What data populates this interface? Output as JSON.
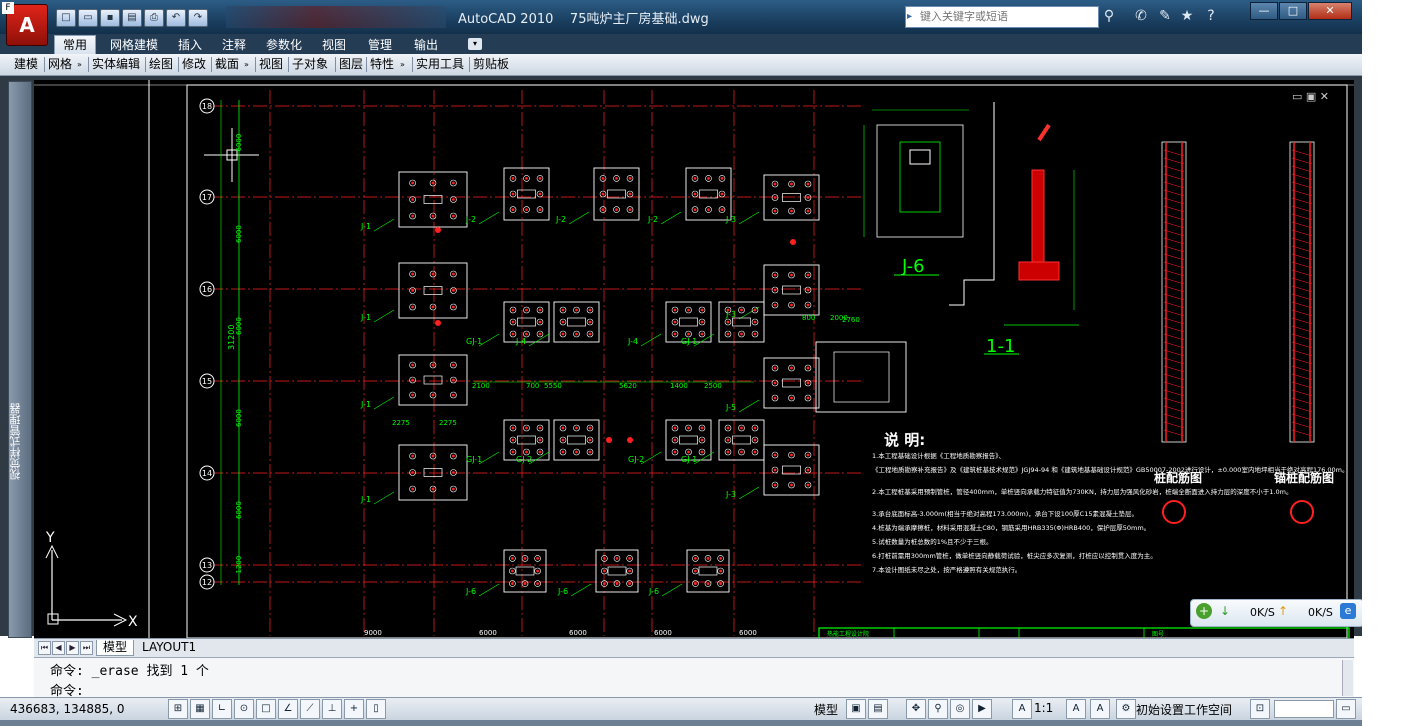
{
  "app": {
    "logo_letter": "A",
    "corner_tag": "F",
    "title": "AutoCAD 2010",
    "file_name": "75吨炉主厂房基础.dwg",
    "search_placeholder": "键入关键字或短语"
  },
  "ribbon": {
    "tabs": [
      "常用",
      "网格建模",
      "插入",
      "注释",
      "参数化",
      "视图",
      "管理",
      "输出"
    ],
    "active_tab": 0,
    "panels": [
      "建模",
      "网格",
      "实体编辑",
      "绘图",
      "修改",
      "截面",
      "视图",
      "子对象",
      "图层",
      "特性",
      "实用工具",
      "剪贴板"
    ]
  },
  "palette": {
    "label": "视觉样式管理器"
  },
  "drawing": {
    "grid_rows": [
      "18",
      "17",
      "16",
      "15",
      "14",
      "13",
      "12"
    ],
    "row_spacing": [
      "6000",
      "6000",
      "6000",
      "6000",
      "6000",
      "1200"
    ],
    "overall_height": "31200",
    "bottom_spacing": [
      "9000",
      "6000",
      "6000",
      "6000",
      "6000"
    ],
    "footing_labels": [
      "J-1",
      "J-2",
      "J-3",
      "J-4",
      "J-5",
      "J-6",
      "GJ-1",
      "GJ-2"
    ],
    "dims_misc": [
      "2275",
      "2275",
      "5550",
      "5620",
      "1400",
      "2500",
      "2100",
      "700",
      "800",
      "2760",
      "2000"
    ],
    "section_detail_title": "J-6",
    "section_title": "1-1",
    "pile_titles": [
      "桩配筋图",
      "锚桩配筋图"
    ],
    "notes_title": "说 明:",
    "notes": [
      "1.本工程基础设计根据《工程地质勘察报告》、",
      "  《工程地质勘察补充报告》及《建筑桩基技术规范》JGJ94-94 和《建筑地基基础设计规范》GB50007-2002进行设计，±0.000室内地坪相当于绝对高程176.00m。",
      "2.本工程桩基采用预制管桩，管径400mm，单桩竖向承载力特征值为730KN，持力层为强风化砂岩，桩端全断面进入持力层的深度不小于1.0m。",
      "3.承台底面标高-3.000m(相当于绝对高程173.000m)，承台下设100厚C15素混凝土垫层。",
      "4.桩基为端承摩擦桩，材料采用混凝土C80，钢筋采用HRB335(Φ)HRB400，保护层厚50mm。",
      "5.试桩数量为桩总数的1%且不少于三根。",
      "6.打桩前需用300mm管桩，做单桩竖向静载荷试验，桩尖应多次复测，打桩应以控制贯入度为主。",
      "7.本设计图纸未尽之处，按严格遵照有关规范执行。"
    ],
    "title_block": [
      "热能工程设计院",
      "",
      "",
      "",
      "图号"
    ]
  },
  "layout_tabs": [
    "模型",
    "LAYOUT1"
  ],
  "command": {
    "history": "命令:  _erase 找到 1 个",
    "prompt": "命令:"
  },
  "status": {
    "coords": "436683, 134885, 0",
    "model_label": "模型",
    "scale": "1:1",
    "workspace": "初始设置工作空间"
  },
  "network": {
    "down": "0K/S",
    "up": "0K/S"
  },
  "ucs": {
    "x": "X",
    "y": "Y"
  }
}
